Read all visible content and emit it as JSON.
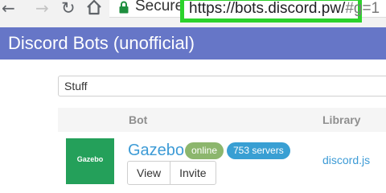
{
  "browser": {
    "secure_label": "Secure",
    "url_main": "https://bots.discord.pw/",
    "url_hash": "#g=1",
    "highlight_color": "#2bd22b"
  },
  "header": {
    "title": "Discord Bots (unofficial)",
    "background": "#6676c7"
  },
  "search": {
    "value": "Stuff"
  },
  "table": {
    "columns": {
      "bot": "Bot",
      "library": "Library"
    },
    "rows": [
      {
        "avatar_text": "Gazebo",
        "name": "Gazebo",
        "status": "online",
        "servers": "753 servers",
        "view_label": "View",
        "invite_label": "Invite",
        "library": "discord.js"
      }
    ]
  },
  "icons": {
    "back": "arrow-left-icon",
    "forward": "arrow-right-icon",
    "reload": "reload-icon",
    "home": "home-icon",
    "secure": "lock-icon"
  },
  "colors": {
    "avatar": "#24a05a",
    "status_online": "#8cb66d",
    "servers_badge": "#399fd3",
    "link": "#3d9bd6"
  }
}
